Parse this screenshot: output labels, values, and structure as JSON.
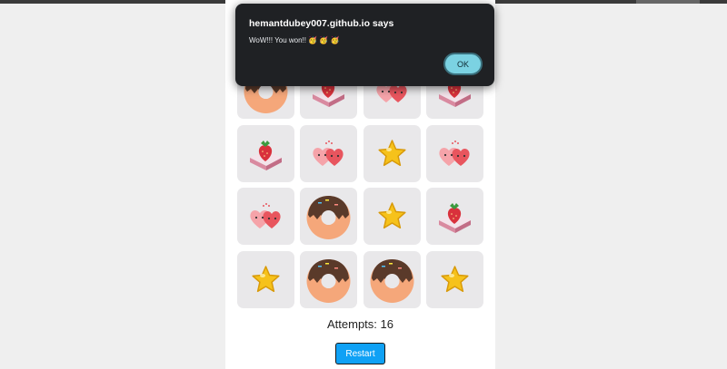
{
  "dialog": {
    "title": "hemantdubey007.github.io says",
    "message": "WoW!!! You won!! 🥳 🥳 🥳",
    "ok_label": "OK"
  },
  "game": {
    "attempts_label": "Attempts: 16",
    "restart_label": "Restart",
    "cards": [
      "donut",
      "strawberry-cake",
      "hearts",
      "strawberry-cake",
      "strawberry-cake",
      "hearts",
      "star",
      "hearts",
      "hearts",
      "donut",
      "star",
      "strawberry-cake",
      "star",
      "donut",
      "donut",
      "star"
    ]
  },
  "colors": {
    "card_bg": "#e9e8ea",
    "restart_bg": "#0fa1f5",
    "dialog_bg": "#1f2124",
    "ok_bg": "#7bd2e2"
  }
}
